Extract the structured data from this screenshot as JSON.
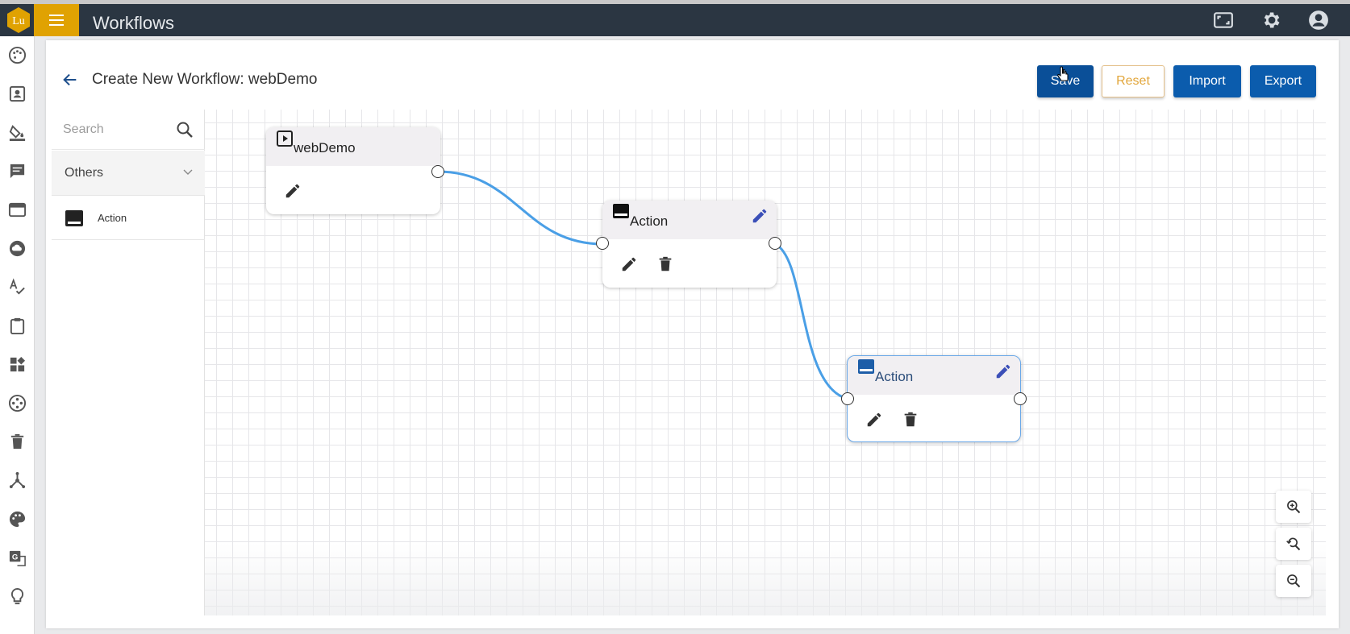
{
  "app": {
    "logo_text": "Lu",
    "title": "Workflows"
  },
  "page": {
    "title": "Create New Workflow: webDemo"
  },
  "toolbar": {
    "save_label": "Save",
    "reset_label": "Reset",
    "import_label": "Import",
    "export_label": "Export"
  },
  "palette": {
    "search_placeholder": "Search",
    "group_label": "Others",
    "items": [
      {
        "label": "Action",
        "icon": "action-icon"
      }
    ]
  },
  "nodes": [
    {
      "title": "webDemo",
      "type": "start",
      "icon": "play-box-icon"
    },
    {
      "title": "Action",
      "type": "action",
      "icon": "action-icon"
    },
    {
      "title": "Action",
      "type": "action",
      "icon": "action-icon",
      "selected": true
    }
  ],
  "colors": {
    "accent": "#e0a202",
    "topbar": "#2b3642",
    "primary": "#0b5cad",
    "link": "#4a9fe6"
  },
  "rail_icons": [
    "palette-icon",
    "contact-card-icon",
    "paint-bucket-icon",
    "message-icon",
    "web-window-icon",
    "cloud-icon",
    "spellcheck-icon",
    "clipboard-icon",
    "dashboard-widgets-icon",
    "film-reel-icon",
    "trash-icon",
    "hub-icon",
    "color-palette-icon",
    "translate-icon",
    "lightbulb-icon"
  ],
  "top_icons": [
    "fullscreen-icon",
    "settings-icon",
    "account-icon"
  ],
  "zoom_icons": [
    "zoom-in-icon",
    "zoom-reset-icon",
    "zoom-out-icon"
  ]
}
